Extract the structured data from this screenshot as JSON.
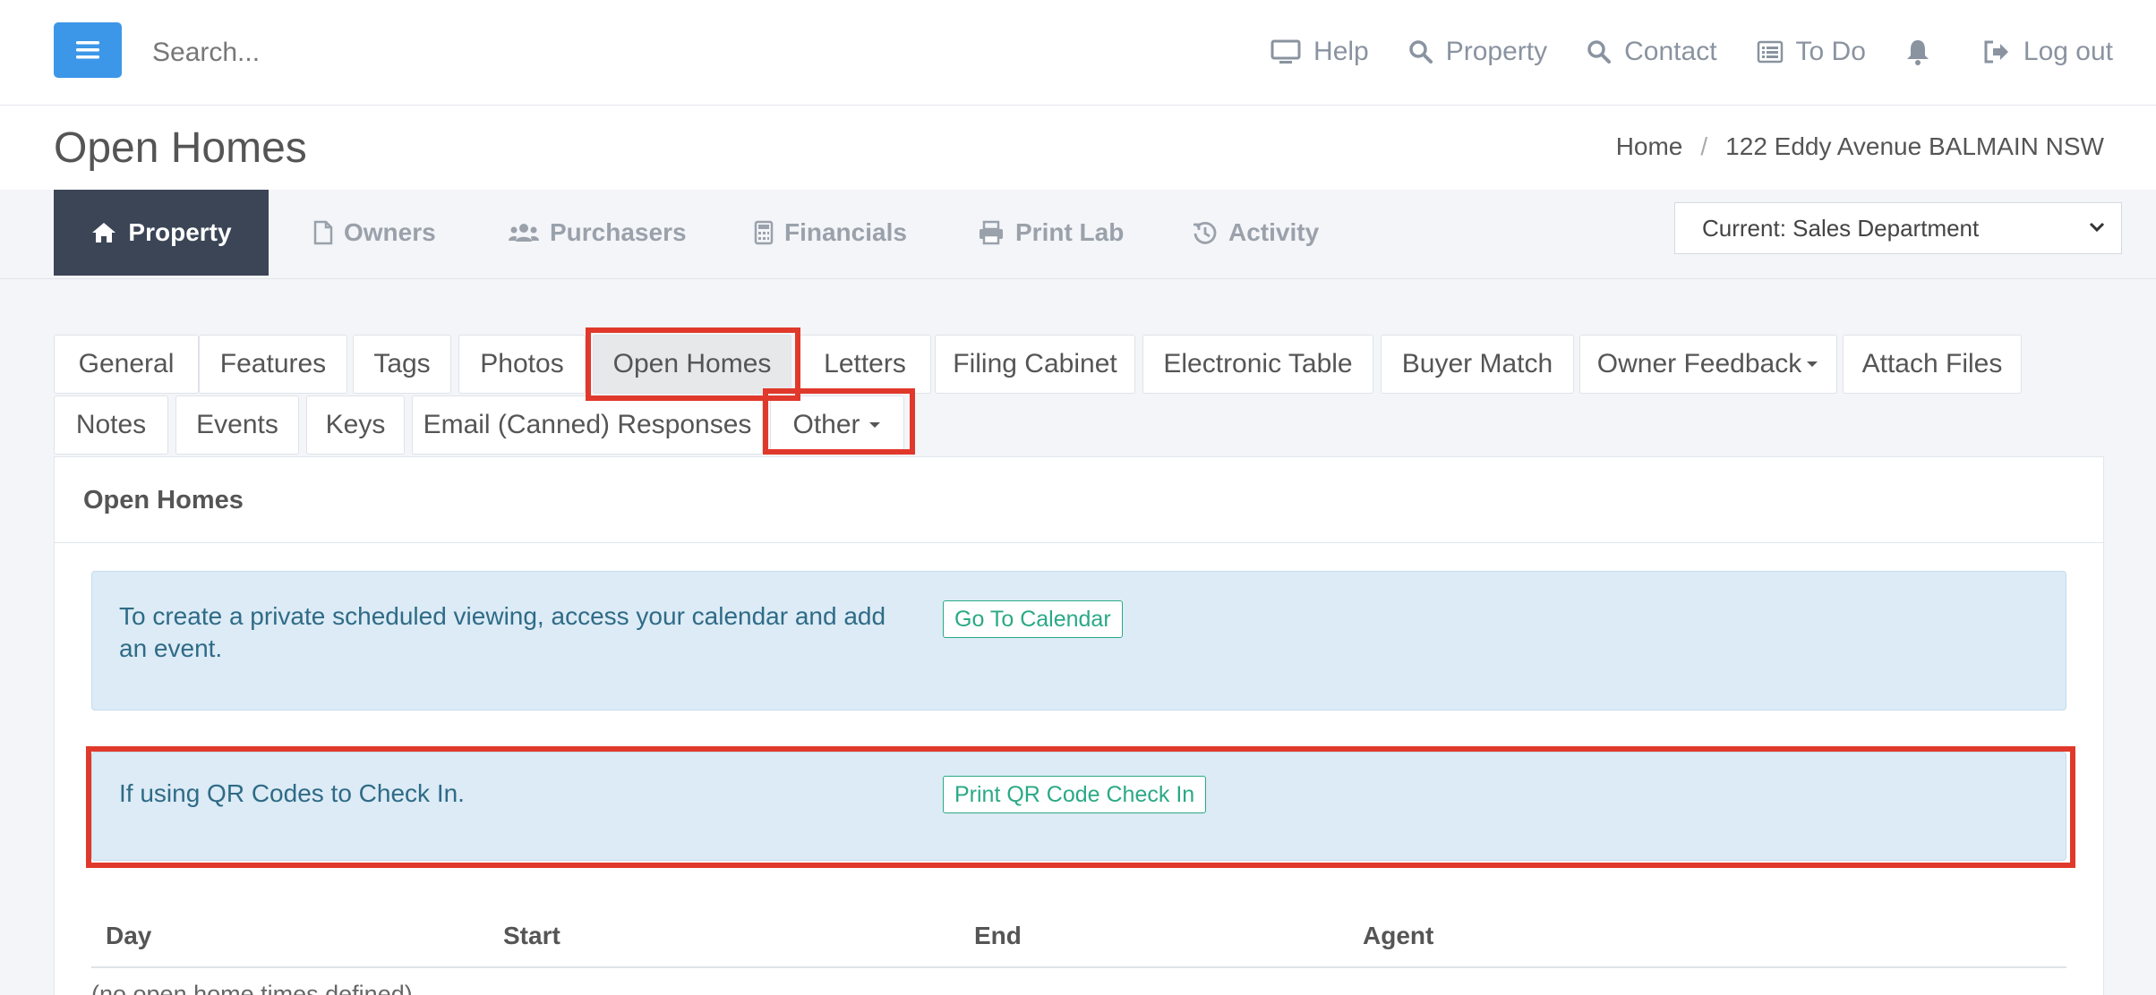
{
  "topbar": {
    "search_placeholder": "Search...",
    "nav": {
      "help": "Help",
      "property": "Property",
      "contact": "Contact",
      "todo": "To Do",
      "logout": "Log out"
    }
  },
  "page": {
    "title": "Open Homes",
    "breadcrumb": {
      "home": "Home",
      "current": "122 Eddy Avenue BALMAIN NSW"
    }
  },
  "main_tabs": {
    "property": "Property",
    "owners": "Owners",
    "purchasers": "Purchasers",
    "financials": "Financials",
    "print_lab": "Print Lab",
    "activity": "Activity"
  },
  "department_select": {
    "selected": "Current: Sales Department"
  },
  "sub_tabs": {
    "general": "General",
    "features": "Features",
    "tags": "Tags",
    "photos": "Photos",
    "open_homes": "Open Homes",
    "letters": "Letters",
    "filing_cabinet": "Filing Cabinet",
    "electronic_table": "Electronic Table",
    "buyer_match": "Buyer Match",
    "owner_feedback": "Owner Feedback",
    "attach_files": "Attach Files",
    "notes": "Notes",
    "events": "Events",
    "keys": "Keys",
    "email_responses": "Email (Canned) Responses",
    "other": "Other"
  },
  "panel": {
    "title": "Open Homes",
    "calendar_alert": {
      "text": "To create a private scheduled viewing, access your calendar and add an event.",
      "button": "Go To Calendar"
    },
    "qr_alert": {
      "text": "If using QR Codes to Check In.",
      "button": "Print QR Code Check In"
    },
    "table": {
      "headers": {
        "day": "Day",
        "start": "Start",
        "end": "End",
        "agent": "Agent"
      },
      "empty": "(no open home times defined)"
    }
  },
  "colors": {
    "accent": "#3c97e8",
    "active_tab": "#3b4556",
    "highlight": "#e0392b",
    "alert_bg": "#dcebf6",
    "alert_button": "#2aa985"
  }
}
